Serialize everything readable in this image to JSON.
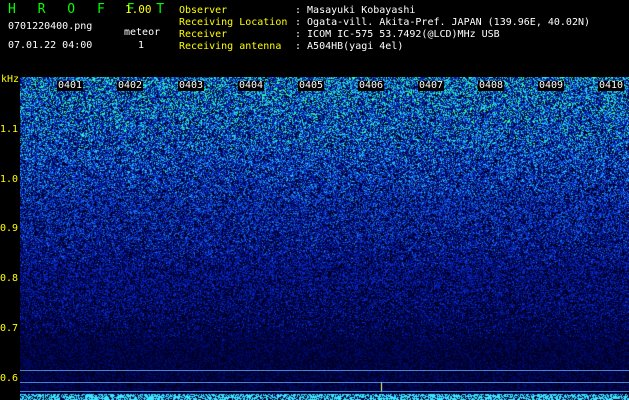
{
  "header": {
    "app_name": "H R O F F T",
    "version": "1.00",
    "filename": "0701220400.png",
    "datetime": "07.01.22 04:00",
    "meteor_label": "meteor",
    "meteor_count": "1",
    "fields": [
      {
        "label": "Observer",
        "value": ": Masayuki Kobayashi"
      },
      {
        "label": "Receiving Location",
        "value": ": Ogata-vill. Akita-Pref. JAPAN (139.96E, 40.02N)"
      },
      {
        "label": "Receiver",
        "value": ": ICOM IC-575 53.7492(@LCD)MHz USB"
      },
      {
        "label": "Receiving antenna",
        "value": ": A504HB(yagi 4el)"
      }
    ]
  },
  "axis": {
    "unit": "kHz",
    "ticks": [
      "1.1",
      "1.0",
      "0.9",
      "0.8",
      "0.7",
      "0.6"
    ]
  },
  "time_labels": [
    "0401",
    "0402",
    "0403",
    "0404",
    "0405",
    "0406",
    "0407",
    "0408",
    "0409",
    "0410"
  ],
  "colors": {
    "background": "#000000",
    "title": "#00ff00",
    "labels": "#ffff00",
    "text": "#ffffff",
    "spectrum_low": "#000044",
    "spectrum_high": "#00ffff"
  }
}
